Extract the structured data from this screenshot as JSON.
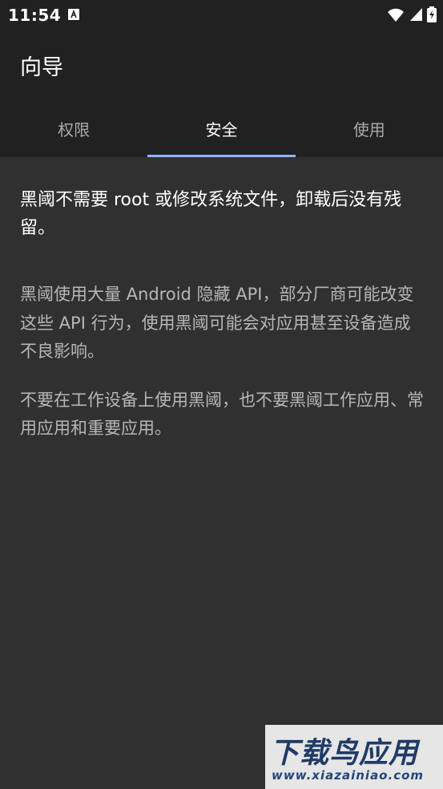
{
  "status_bar": {
    "time": "11:54",
    "icons": [
      "text-notification-icon",
      "wifi-icon",
      "signal-icon",
      "battery-charging-icon"
    ]
  },
  "app_bar": {
    "title": "向导"
  },
  "tabs": [
    {
      "label": "权限",
      "active": false
    },
    {
      "label": "安全",
      "active": true
    },
    {
      "label": "使用",
      "active": false
    }
  ],
  "content": {
    "lead": "黑阈不需要 root 或修改系统文件，卸载后没有残留。",
    "paragraphs": [
      "黑阈使用大量 Android 隐藏 API，部分厂商可能改变这些 API 行为，使用黑阈可能会对应用甚至设备造成不良影响。",
      "不要在工作设备上使用黑阈，也不要黑阈工作应用、常用应用和重要应用。"
    ]
  },
  "watermark": {
    "name": "下载鸟应用",
    "url": "www.xiazainiao.com"
  },
  "colors": {
    "background": "#303030",
    "app_bar": "#212121",
    "accent": "#8ab4f8",
    "secondary_text": "#b7b7b7"
  }
}
